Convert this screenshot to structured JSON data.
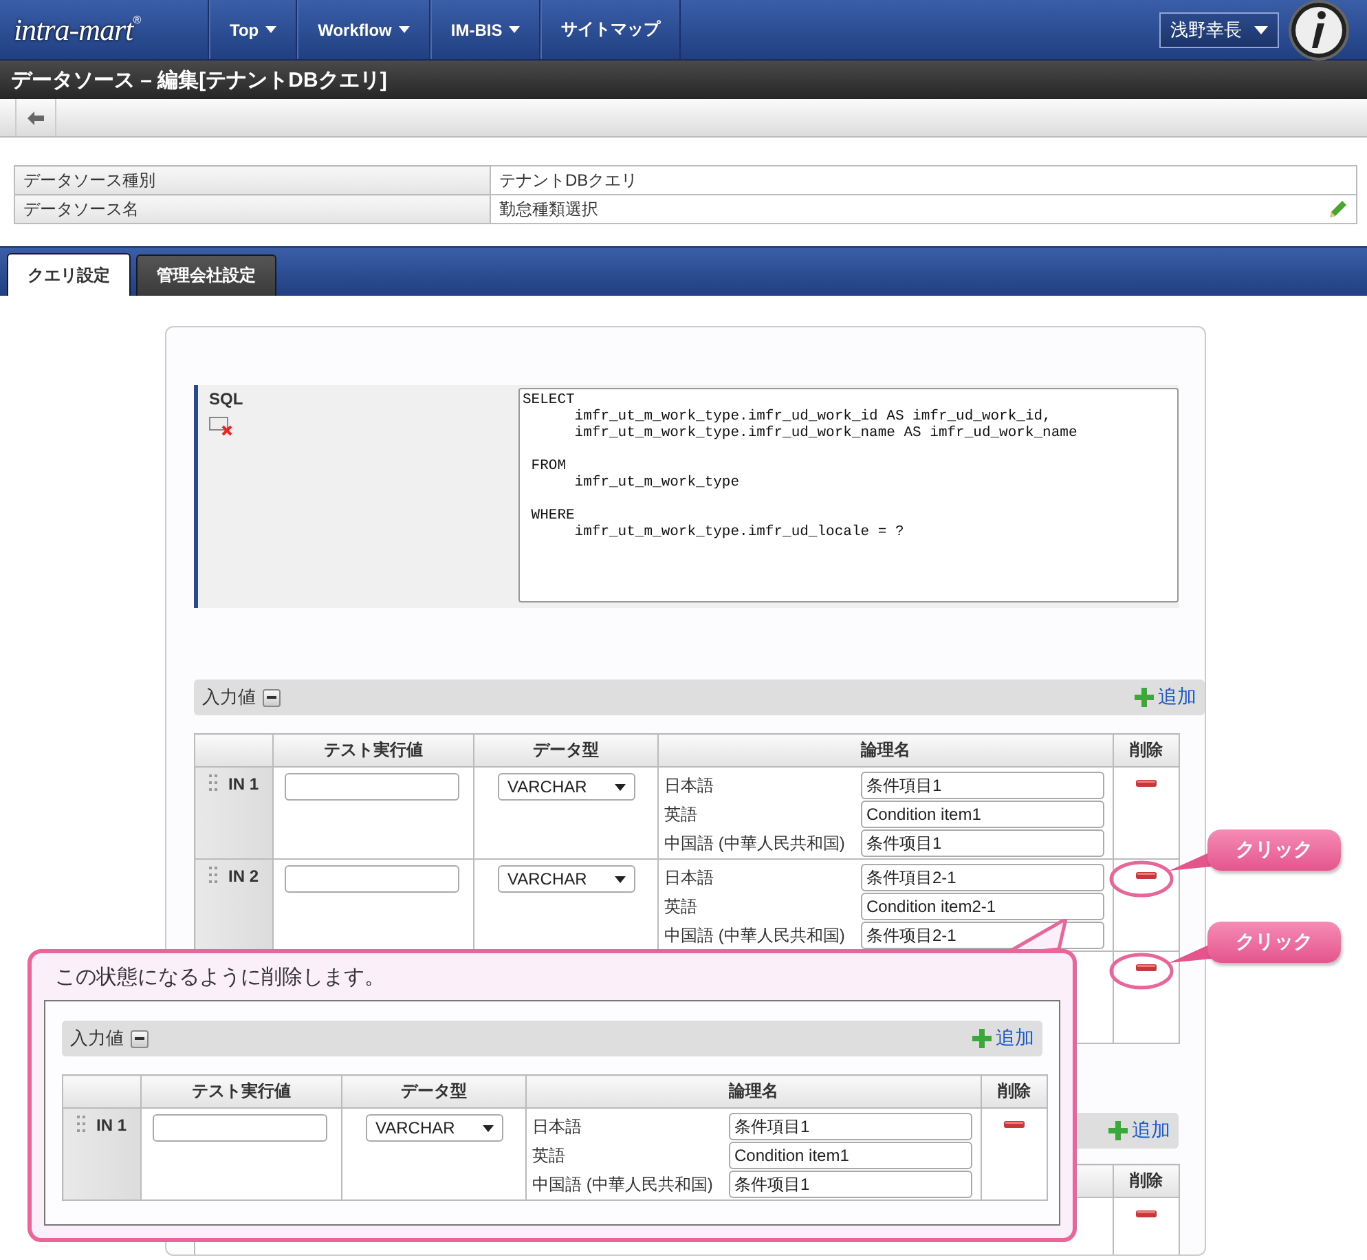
{
  "header": {
    "logo": "intra-mart",
    "logo_mark": "®",
    "nav": [
      {
        "label": "Top",
        "dropdown": true
      },
      {
        "label": "Workflow",
        "dropdown": true
      },
      {
        "label": "IM-BIS",
        "dropdown": true
      },
      {
        "label": "サイトマップ",
        "dropdown": false
      }
    ],
    "user": "浅野幸長"
  },
  "page_title": "データソース – 編集[テナントDBクエリ]",
  "info": [
    {
      "label": "データソース種別",
      "value": "テナントDBクエリ",
      "editable": false
    },
    {
      "label": "データソース名",
      "value": "勤怠種類選択",
      "editable": true
    }
  ],
  "tabs": [
    {
      "label": "クエリ設定",
      "selected": true
    },
    {
      "label": "管理会社設定",
      "selected": false
    }
  ],
  "sql": {
    "label": "SQL",
    "value": "SELECT\n      imfr_ut_m_work_type.imfr_ud_work_id AS imfr_ud_work_id,\n      imfr_ut_m_work_type.imfr_ud_work_name AS imfr_ud_work_name\n\n FROM\n      imfr_ut_m_work_type\n\n WHERE\n      imfr_ut_m_work_type.imfr_ud_locale = ?"
  },
  "inputs": {
    "title": "入力値",
    "add_label": "追加",
    "columns": [
      "テスト実行値",
      "データ型",
      "論理名",
      "削除"
    ],
    "rows": [
      {
        "kind": "entry",
        "id": "IN 1",
        "data_type": "VARCHAR",
        "names": [
          {
            "lang": "日本語",
            "value": "条件項目1"
          },
          {
            "lang": "英語",
            "value": "Condition item1"
          },
          {
            "lang": "中国語 (中華人民共和国)",
            "value": "条件项目1"
          }
        ]
      },
      {
        "kind": "entry",
        "id": "IN 2",
        "data_type": "VARCHAR",
        "names": [
          {
            "lang": "日本語",
            "value": "条件項目2-1"
          },
          {
            "lang": "英語",
            "value": "Condition item2-1"
          },
          {
            "lang": "中国語 (中華人民共和国)",
            "value": "条件项目2-1"
          }
        ]
      },
      {
        "kind": "covered"
      }
    ]
  },
  "lower_section": {
    "add_label": "追加",
    "delete_header": "削除"
  },
  "callouts": [
    {
      "text": "クリック"
    },
    {
      "text": "クリック"
    }
  ],
  "note": {
    "text": "この状態になるように削除します。",
    "preview": {
      "title": "入力値",
      "add_label": "追加",
      "columns": [
        "テスト実行値",
        "データ型",
        "論理名",
        "削除"
      ],
      "rows": [
        {
          "kind": "entry",
          "id": "IN 1",
          "data_type": "VARCHAR",
          "names": [
            {
              "lang": "日本語",
              "value": "条件項目1"
            },
            {
              "lang": "英語",
              "value": "Condition item1"
            },
            {
              "lang": "中国語 (中華人民共和国)",
              "value": "条件项目1"
            }
          ]
        }
      ]
    }
  }
}
